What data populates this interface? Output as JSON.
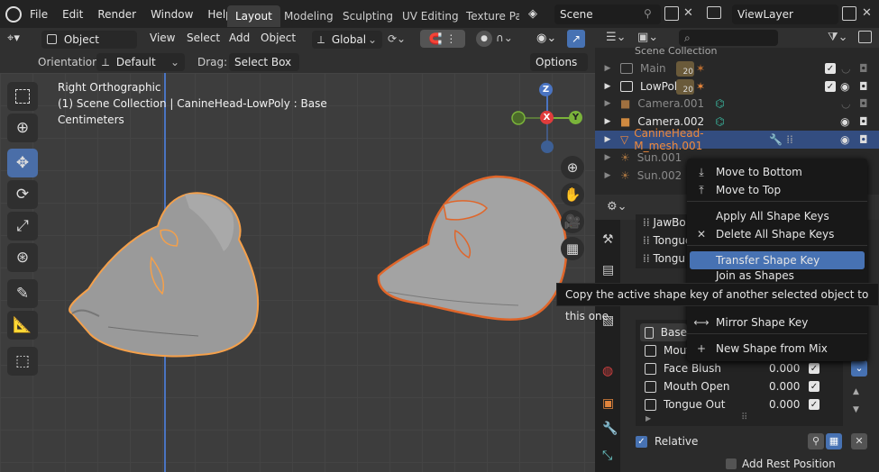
{
  "topbar": {
    "menus": [
      "File",
      "Edit",
      "Render",
      "Window",
      "Help"
    ],
    "workspaces": [
      "Layout",
      "Modeling",
      "Sculpting",
      "UV Editing",
      "Texture Pai"
    ],
    "active_workspace": "Layout",
    "scene": "Scene",
    "view_layer": "ViewLayer"
  },
  "viewport_header": {
    "mode": "Object Mode",
    "menus": [
      "View",
      "Select",
      "Add",
      "Object"
    ],
    "transform": "Global"
  },
  "tool_settings": {
    "orientation_label": "Orientation:",
    "orientation_value": "Default",
    "drag_label": "Drag:",
    "drag_value": "Select Box",
    "options": "Options"
  },
  "viewport": {
    "view_name": "Right Orthographic",
    "collection_info": "(1) Scene Collection | CanineHead-LowPoly : Base",
    "units": "Centimeters",
    "gizmo": {
      "z": "Z",
      "x": "X",
      "y": "Y"
    }
  },
  "outliner": {
    "root": "Scene Collection",
    "items": [
      {
        "name": "Main",
        "badge": "20",
        "color": "#8a8a8a"
      },
      {
        "name": "LowPoly",
        "badge": "20",
        "color": "#e5e5e5"
      },
      {
        "name": "Camera.001",
        "color": "#8a8a8a"
      },
      {
        "name": "Camera.002",
        "color": "#e5e5e5"
      },
      {
        "name": "CanineHead-M_mesh.001",
        "color": "#f08a3c"
      },
      {
        "name": "Sun.001",
        "color": "#8a8a8a"
      },
      {
        "name": "Sun.002",
        "color": "#8a8a8a"
      }
    ]
  },
  "properties": {
    "partial_rows": [
      "JawBo",
      "Tongue",
      "Tongu"
    ],
    "shape_keys": [
      {
        "name": "Base",
        "value": ""
      },
      {
        "name": "Mouth",
        "value": ""
      },
      {
        "name": "Face Blush",
        "value": "0.000"
      },
      {
        "name": "Mouth Open",
        "value": "0.000"
      },
      {
        "name": "Tongue Out",
        "value": "0.000"
      }
    ],
    "relative_label": "Relative",
    "add_rest_label": "Add Rest Position"
  },
  "context_menu": {
    "items": [
      {
        "label": "Move to Bottom",
        "icon": "move-bottom-icon"
      },
      {
        "label": "Move to Top",
        "icon": "move-top-icon"
      },
      {
        "label": "Apply All Shape Keys",
        "icon": ""
      },
      {
        "label": "Delete All Shape Keys",
        "icon": "x-icon"
      },
      {
        "label": "Transfer Shape Key",
        "icon": "",
        "selected": true
      },
      {
        "label": "Join as Shapes",
        "icon": ""
      },
      {
        "label": "Mirror Shape Key",
        "icon": "mirror-icon"
      },
      {
        "label": "New Shape from Mix",
        "icon": "plus-icon"
      }
    ]
  },
  "tooltip": "Copy the active shape key of another selected object to this one.",
  "colors": {
    "accent": "#4772b3",
    "selected_orange": "#f08a3c",
    "active_tool": "#4a6ea8"
  }
}
